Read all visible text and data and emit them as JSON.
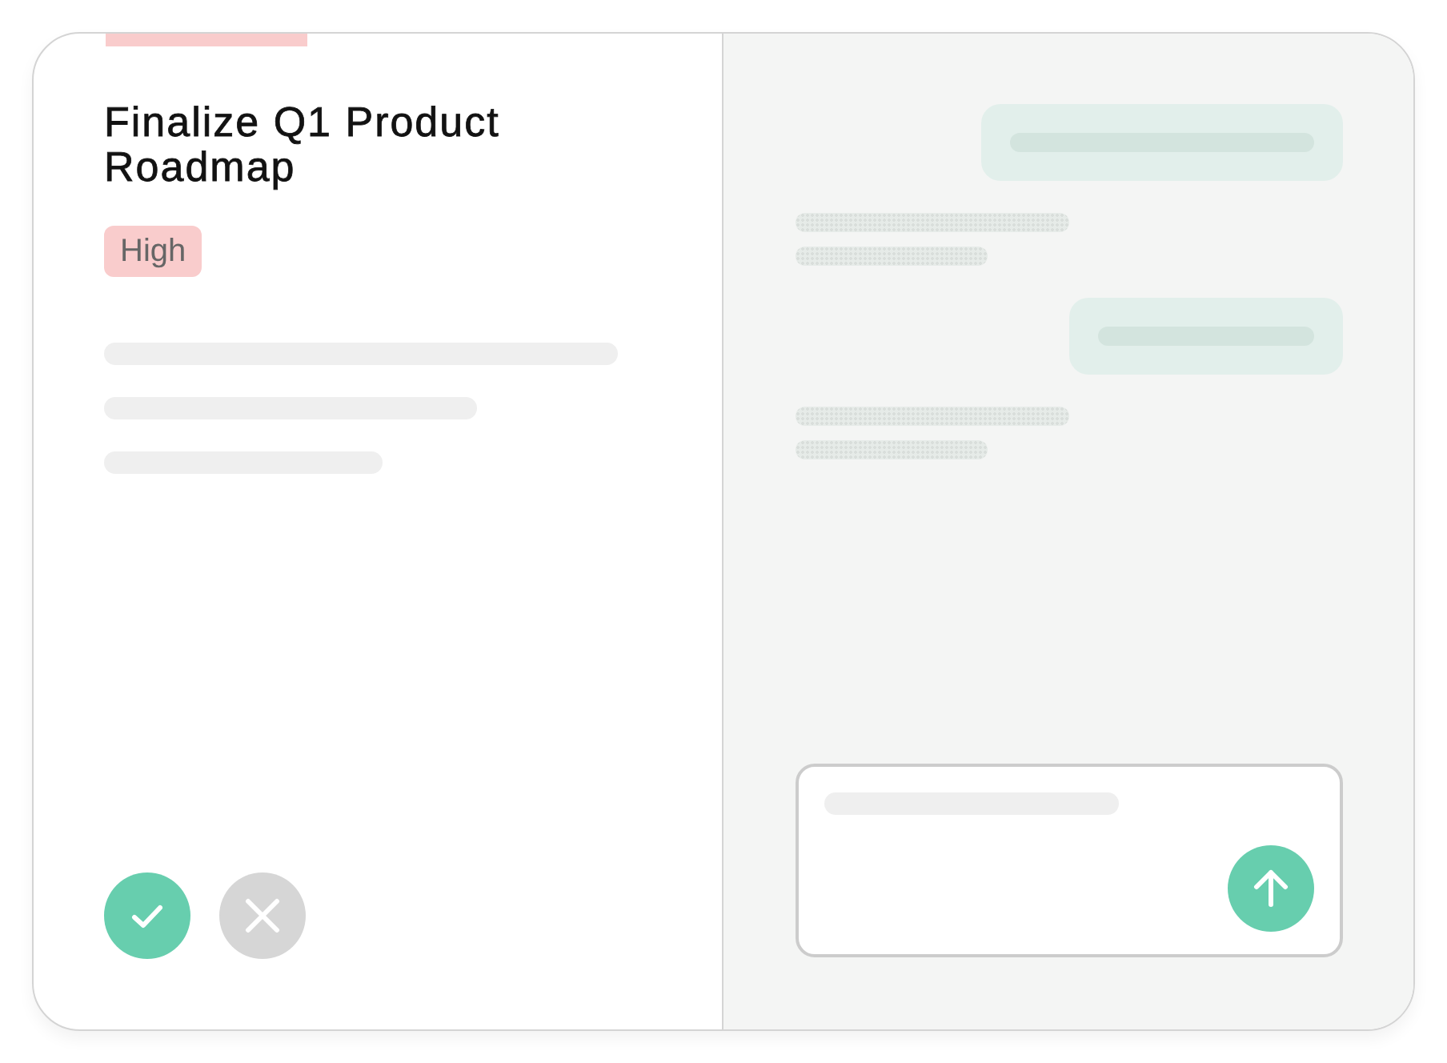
{
  "task": {
    "title": "Finalize Q1 Product Roadmap",
    "priority": "High"
  },
  "chat": {
    "messages": [
      {
        "kind": "sent"
      },
      {
        "kind": "received"
      },
      {
        "kind": "sent"
      },
      {
        "kind": "received"
      }
    ]
  }
}
